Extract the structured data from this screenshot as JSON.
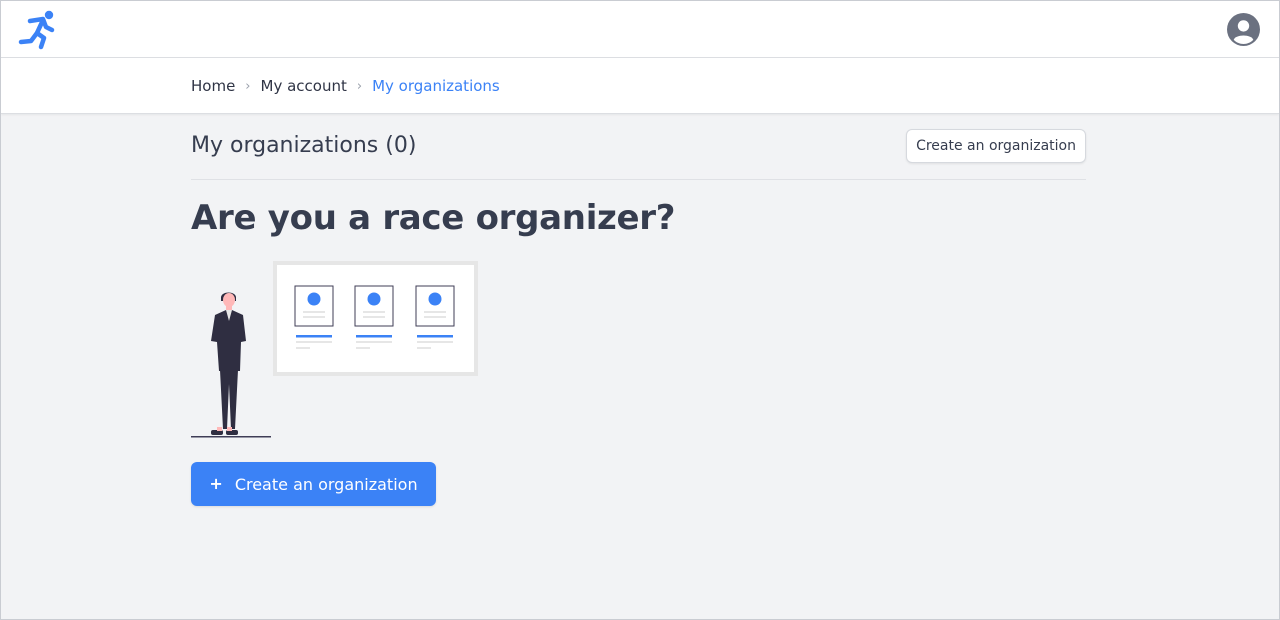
{
  "header": {
    "logo_icon": "runner-icon",
    "avatar_icon": "user-circle-icon"
  },
  "breadcrumb": {
    "items": [
      "Home",
      "My account",
      "My organizations"
    ],
    "separator": "›"
  },
  "section": {
    "title": "My organizations (0)",
    "create_button_label": "Create an organization"
  },
  "empty_state": {
    "headline": "Are you a race organizer?",
    "illustration_icon": "person-with-board-illustration",
    "cta_icon": "+",
    "cta_label": "Create an organization"
  },
  "colors": {
    "accent": "#3b82f6",
    "background": "#f2f3f5",
    "text": "#363d4f"
  }
}
